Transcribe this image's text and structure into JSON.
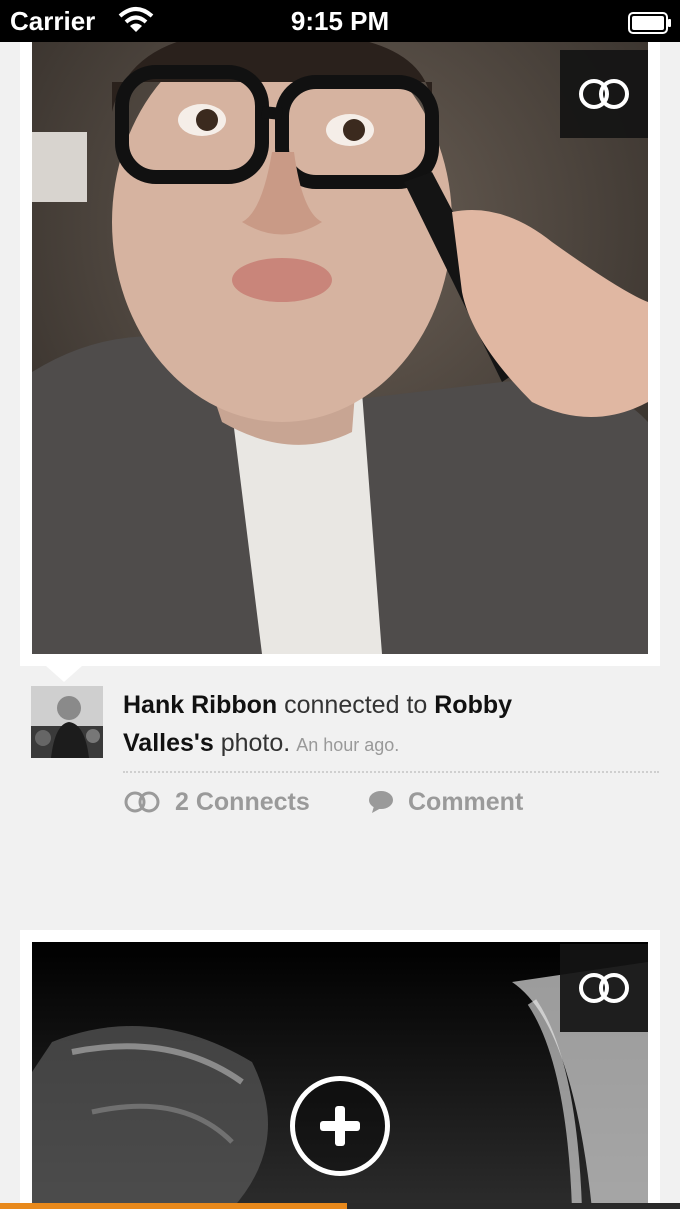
{
  "status_bar": {
    "carrier": "Carrier",
    "time": "9:15 PM"
  },
  "feed": {
    "post": {
      "actor": "Hank Ribbon",
      "verb": "connected to",
      "target_owner": "Robby Valles's",
      "object": "photo.",
      "timestamp": "An hour ago.",
      "connects_label": "2 Connects",
      "comment_label": "Comment"
    }
  },
  "icons": {
    "connect": "connect-rings-icon",
    "comment": "speech-bubble-icon",
    "add": "plus-icon",
    "wifi": "wifi-icon",
    "battery": "battery-icon"
  },
  "colors": {
    "accent": "#e8891c",
    "muted_text": "#9a9a9a",
    "background": "#f1f1f1"
  },
  "scroll_progress": 0.51
}
